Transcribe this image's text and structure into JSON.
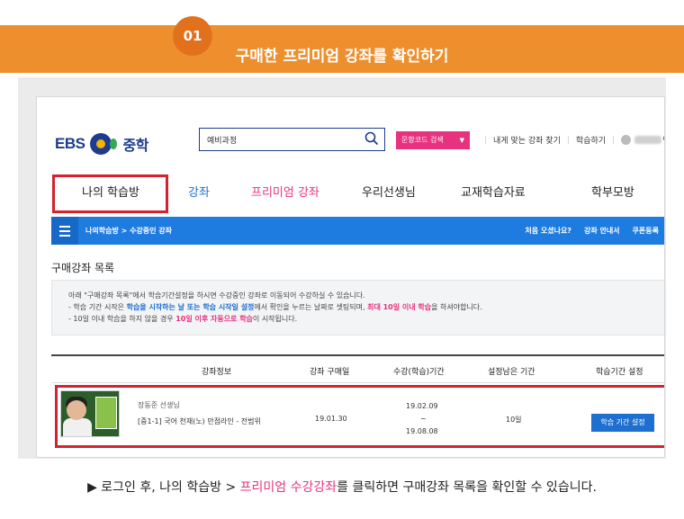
{
  "step": {
    "number": "01",
    "title": "구매한 프리미엄 강좌를 확인하기"
  },
  "header": {
    "logo_text": "EBS",
    "logo_sub": "중학",
    "search_value": "예비과정",
    "code_search_label": "문항코드 검색",
    "links": [
      "내게 맞는 강좌 찾기",
      "학습하기"
    ],
    "user_suffix": "님"
  },
  "nav": {
    "items": [
      {
        "label": "나의 학습방"
      },
      {
        "label": "강좌"
      },
      {
        "label": "프리미엄 강좌"
      },
      {
        "label": "우리선생님"
      },
      {
        "label": "교재학습자료"
      },
      {
        "label": "학부모방"
      }
    ]
  },
  "bluebar": {
    "breadcrumb": "나의학습방 > 수강중인 강좌",
    "links": [
      "처음 오셨나요?",
      "강좌 안내서",
      "쿠폰등록"
    ]
  },
  "section_title": "구매강좌 목록",
  "notice": {
    "line1": "아래 \"구매강좌 목록\"에서 학습기간설정을 하시면 수강중인 강좌로 이동되어 수강하실 수 있습니다.",
    "line2_a": "- 학습 기간 시작은 ",
    "line2_hl": "학습을 시작하는 날 또는 학습 시작일 설정",
    "line2_b": "에서 확인을 누르는 날짜로 셋팅되며, ",
    "line2_red": "최대 10일 이내 학습",
    "line2_c": "을 하셔야합니다.",
    "line3_a": "- 10일 이내 학습을 하지 않을 경우 ",
    "line3_red": "10일 이후 자동으로 학습",
    "line3_b": "이 시작됩니다."
  },
  "table": {
    "headers": [
      "강좌정보",
      "강좌 구매일",
      "수강(학습)기간",
      "설정남은 기간",
      "학습기간 설정"
    ],
    "row": {
      "teacher": "장동준 선생님",
      "course": "[중1-1] 국어 천재(노) 만점라인 - 전범위",
      "purchase_date": "19.01.30",
      "period_start": "19.02.09",
      "period_sep": "~",
      "period_end": "19.08.08",
      "remaining": "10일",
      "button": "학습 기간 설정"
    }
  },
  "caption": {
    "prefix": "▶ 로그인 후, 나의 학습방 > ",
    "highlight": "프리미엄 수강강좌",
    "suffix": "를 클릭하면 구매강좌 목록을 확인할 수 있습니다."
  },
  "colors": {
    "orange": "#ee8f2e",
    "blue": "#1e7be0",
    "pink": "#e8327f",
    "highlight_red": "#d4222e"
  }
}
